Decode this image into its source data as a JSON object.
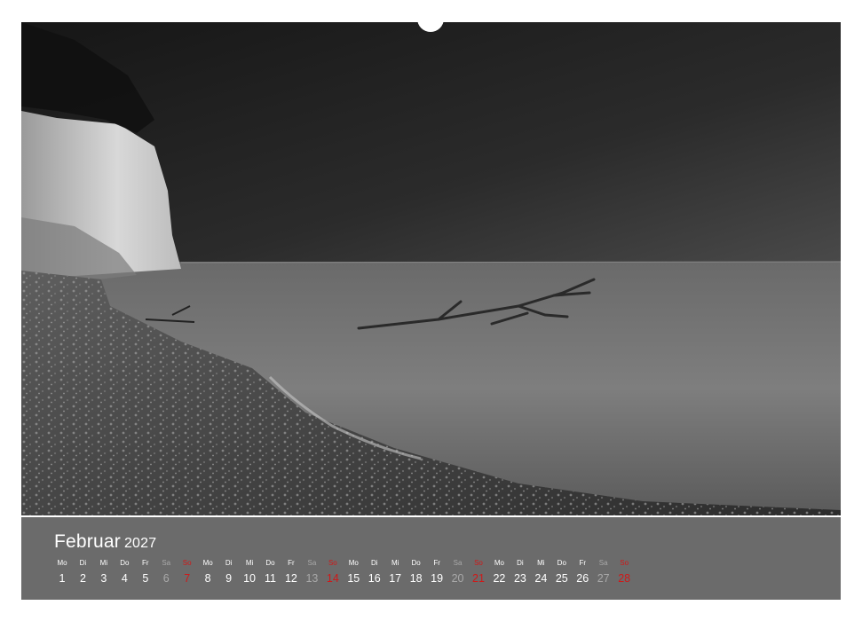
{
  "calendar": {
    "month": "Februar",
    "year": "2027",
    "weekday_labels": [
      "Mo",
      "Di",
      "Mi",
      "Do",
      "Fr",
      "Sa",
      "So",
      "Mo",
      "Di",
      "Mi",
      "Do",
      "Fr",
      "Sa",
      "So",
      "Mo",
      "Di",
      "Mi",
      "Do",
      "Fr",
      "Sa",
      "So",
      "Mo",
      "Di",
      "Mi",
      "Do",
      "Fr",
      "Sa",
      "So"
    ],
    "days": [
      "1",
      "2",
      "3",
      "4",
      "5",
      "6",
      "7",
      "8",
      "9",
      "10",
      "11",
      "12",
      "13",
      "14",
      "15",
      "16",
      "17",
      "18",
      "19",
      "20",
      "21",
      "22",
      "23",
      "24",
      "25",
      "26",
      "27",
      "28"
    ],
    "colors": {
      "weekday": "#ffffff",
      "saturday": "#a9a9a9",
      "sunday": "#d01818",
      "panel": "#6b6b6b"
    }
  },
  "photo": {
    "subject": "black-and-white coastal photo: white chalk cliff, pebble beach, calm sea and driftwood"
  }
}
